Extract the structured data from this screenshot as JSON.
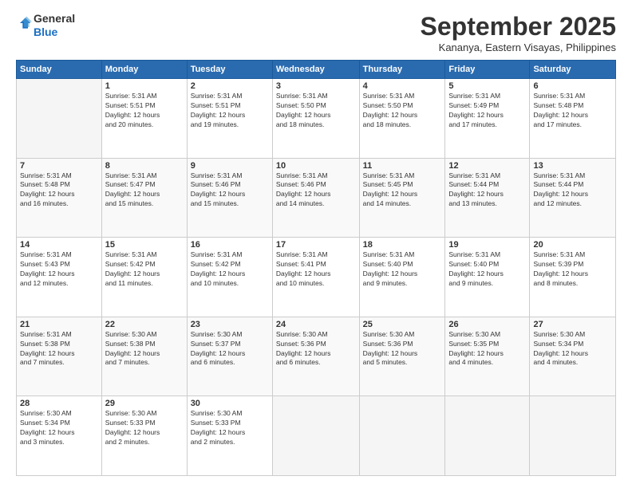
{
  "header": {
    "logo_line1": "General",
    "logo_line2": "Blue",
    "month": "September 2025",
    "location": "Kananya, Eastern Visayas, Philippines"
  },
  "weekdays": [
    "Sunday",
    "Monday",
    "Tuesday",
    "Wednesday",
    "Thursday",
    "Friday",
    "Saturday"
  ],
  "weeks": [
    [
      {
        "day": "",
        "info": ""
      },
      {
        "day": "1",
        "info": "Sunrise: 5:31 AM\nSunset: 5:51 PM\nDaylight: 12 hours\nand 20 minutes."
      },
      {
        "day": "2",
        "info": "Sunrise: 5:31 AM\nSunset: 5:51 PM\nDaylight: 12 hours\nand 19 minutes."
      },
      {
        "day": "3",
        "info": "Sunrise: 5:31 AM\nSunset: 5:50 PM\nDaylight: 12 hours\nand 18 minutes."
      },
      {
        "day": "4",
        "info": "Sunrise: 5:31 AM\nSunset: 5:50 PM\nDaylight: 12 hours\nand 18 minutes."
      },
      {
        "day": "5",
        "info": "Sunrise: 5:31 AM\nSunset: 5:49 PM\nDaylight: 12 hours\nand 17 minutes."
      },
      {
        "day": "6",
        "info": "Sunrise: 5:31 AM\nSunset: 5:48 PM\nDaylight: 12 hours\nand 17 minutes."
      }
    ],
    [
      {
        "day": "7",
        "info": "Sunrise: 5:31 AM\nSunset: 5:48 PM\nDaylight: 12 hours\nand 16 minutes."
      },
      {
        "day": "8",
        "info": "Sunrise: 5:31 AM\nSunset: 5:47 PM\nDaylight: 12 hours\nand 15 minutes."
      },
      {
        "day": "9",
        "info": "Sunrise: 5:31 AM\nSunset: 5:46 PM\nDaylight: 12 hours\nand 15 minutes."
      },
      {
        "day": "10",
        "info": "Sunrise: 5:31 AM\nSunset: 5:46 PM\nDaylight: 12 hours\nand 14 minutes."
      },
      {
        "day": "11",
        "info": "Sunrise: 5:31 AM\nSunset: 5:45 PM\nDaylight: 12 hours\nand 14 minutes."
      },
      {
        "day": "12",
        "info": "Sunrise: 5:31 AM\nSunset: 5:44 PM\nDaylight: 12 hours\nand 13 minutes."
      },
      {
        "day": "13",
        "info": "Sunrise: 5:31 AM\nSunset: 5:44 PM\nDaylight: 12 hours\nand 12 minutes."
      }
    ],
    [
      {
        "day": "14",
        "info": "Sunrise: 5:31 AM\nSunset: 5:43 PM\nDaylight: 12 hours\nand 12 minutes."
      },
      {
        "day": "15",
        "info": "Sunrise: 5:31 AM\nSunset: 5:42 PM\nDaylight: 12 hours\nand 11 minutes."
      },
      {
        "day": "16",
        "info": "Sunrise: 5:31 AM\nSunset: 5:42 PM\nDaylight: 12 hours\nand 10 minutes."
      },
      {
        "day": "17",
        "info": "Sunrise: 5:31 AM\nSunset: 5:41 PM\nDaylight: 12 hours\nand 10 minutes."
      },
      {
        "day": "18",
        "info": "Sunrise: 5:31 AM\nSunset: 5:40 PM\nDaylight: 12 hours\nand 9 minutes."
      },
      {
        "day": "19",
        "info": "Sunrise: 5:31 AM\nSunset: 5:40 PM\nDaylight: 12 hours\nand 9 minutes."
      },
      {
        "day": "20",
        "info": "Sunrise: 5:31 AM\nSunset: 5:39 PM\nDaylight: 12 hours\nand 8 minutes."
      }
    ],
    [
      {
        "day": "21",
        "info": "Sunrise: 5:31 AM\nSunset: 5:38 PM\nDaylight: 12 hours\nand 7 minutes."
      },
      {
        "day": "22",
        "info": "Sunrise: 5:30 AM\nSunset: 5:38 PM\nDaylight: 12 hours\nand 7 minutes."
      },
      {
        "day": "23",
        "info": "Sunrise: 5:30 AM\nSunset: 5:37 PM\nDaylight: 12 hours\nand 6 minutes."
      },
      {
        "day": "24",
        "info": "Sunrise: 5:30 AM\nSunset: 5:36 PM\nDaylight: 12 hours\nand 6 minutes."
      },
      {
        "day": "25",
        "info": "Sunrise: 5:30 AM\nSunset: 5:36 PM\nDaylight: 12 hours\nand 5 minutes."
      },
      {
        "day": "26",
        "info": "Sunrise: 5:30 AM\nSunset: 5:35 PM\nDaylight: 12 hours\nand 4 minutes."
      },
      {
        "day": "27",
        "info": "Sunrise: 5:30 AM\nSunset: 5:34 PM\nDaylight: 12 hours\nand 4 minutes."
      }
    ],
    [
      {
        "day": "28",
        "info": "Sunrise: 5:30 AM\nSunset: 5:34 PM\nDaylight: 12 hours\nand 3 minutes."
      },
      {
        "day": "29",
        "info": "Sunrise: 5:30 AM\nSunset: 5:33 PM\nDaylight: 12 hours\nand 2 minutes."
      },
      {
        "day": "30",
        "info": "Sunrise: 5:30 AM\nSunset: 5:33 PM\nDaylight: 12 hours\nand 2 minutes."
      },
      {
        "day": "",
        "info": ""
      },
      {
        "day": "",
        "info": ""
      },
      {
        "day": "",
        "info": ""
      },
      {
        "day": "",
        "info": ""
      }
    ]
  ]
}
